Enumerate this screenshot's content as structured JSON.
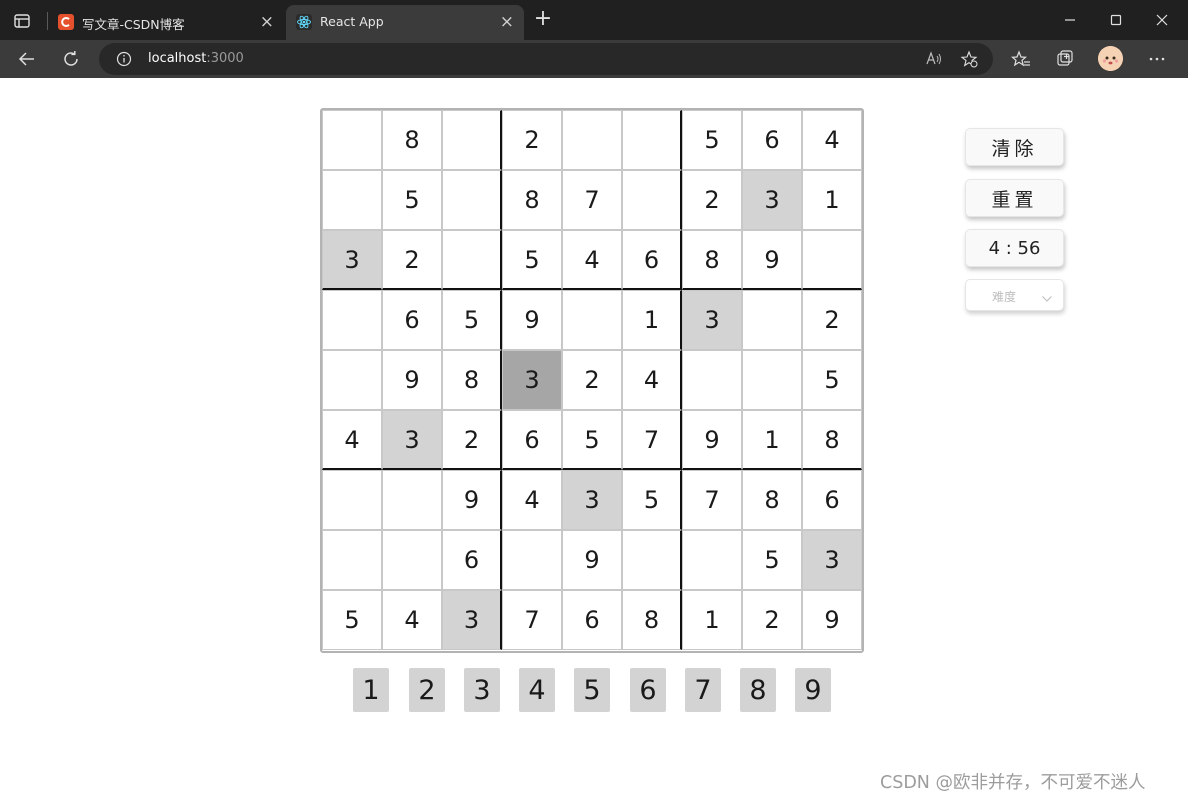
{
  "browser": {
    "tabs": [
      {
        "title": "写文章-CSDN博客",
        "active": false,
        "favicon": "csdn-logo"
      },
      {
        "title": "React App",
        "active": true,
        "favicon": "react-logo"
      }
    ],
    "new_tab_icon": "plus-icon",
    "url_host": "localhost",
    "url_port": ":3000"
  },
  "board": {
    "rows": [
      [
        "",
        "8",
        "",
        "2",
        "",
        "",
        "5",
        "6",
        "4"
      ],
      [
        "",
        "5",
        "",
        "8",
        "7",
        "",
        "2",
        "3",
        "1"
      ],
      [
        "3",
        "2",
        "",
        "5",
        "4",
        "6",
        "8",
        "9",
        ""
      ],
      [
        "",
        "6",
        "5",
        "9",
        "",
        "1",
        "3",
        "",
        "2"
      ],
      [
        "",
        "9",
        "8",
        "3",
        "2",
        "4",
        "",
        "",
        "5"
      ],
      [
        "4",
        "3",
        "2",
        "6",
        "5",
        "7",
        "9",
        "1",
        "8"
      ],
      [
        "",
        "",
        "9",
        "4",
        "3",
        "5",
        "7",
        "8",
        "6"
      ],
      [
        "",
        "",
        "6",
        "",
        "9",
        "",
        "",
        "5",
        "3"
      ],
      [
        "5",
        "4",
        "3",
        "7",
        "6",
        "8",
        "1",
        "2",
        "9"
      ]
    ],
    "highlighted": [
      [
        1,
        7
      ],
      [
        2,
        0
      ],
      [
        3,
        6
      ],
      [
        5,
        1
      ],
      [
        6,
        4
      ],
      [
        7,
        8
      ],
      [
        8,
        2
      ]
    ],
    "selected": [
      4,
      3
    ],
    "highlight_color": "#d3d3d3",
    "selected_color": "#a6a6a6"
  },
  "number_pad": [
    "1",
    "2",
    "3",
    "4",
    "5",
    "6",
    "7",
    "8",
    "9"
  ],
  "controls": {
    "clear_label": "清除",
    "reset_label": "重置",
    "timer": "4 : 56",
    "difficulty_placeholder": "难度"
  },
  "watermark": "CSDN @欧非并存，不可爱不迷人"
}
